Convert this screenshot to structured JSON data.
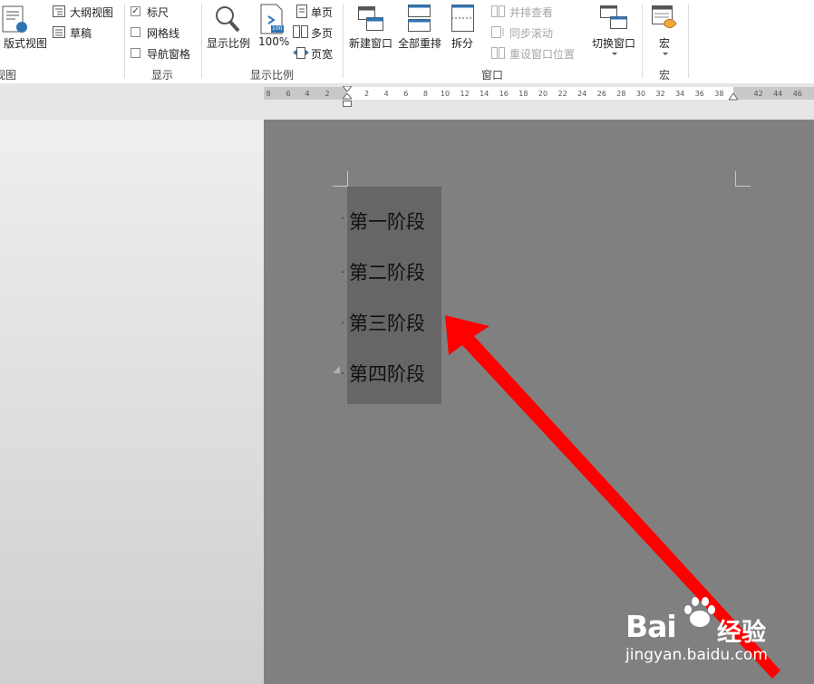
{
  "ribbon": {
    "view_group": {
      "print_layout_label": "版式视图",
      "outline_label": "大纲视图",
      "draft_label": "草稿",
      "group_label": "视图"
    },
    "show_group": {
      "ruler_label": "标尺",
      "ruler_checked": "✓",
      "gridlines_label": "网格线",
      "nav_pane_label": "导航窗格",
      "group_label": "显示"
    },
    "zoom_group": {
      "zoom_label": "显示比例",
      "hundred_label": "100%",
      "hundred_badge": "100",
      "one_page_label": "单页",
      "multi_page_label": "多页",
      "page_width_label": "页宽",
      "group_label": "显示比例"
    },
    "window_group": {
      "new_window_label": "新建窗口",
      "arrange_all_label": "全部重排",
      "split_label": "拆分",
      "side_by_side_label": "并排查看",
      "sync_scroll_label": "同步滚动",
      "reset_position_label": "重设窗口位置",
      "switch_windows_label": "切换窗口",
      "group_label": "窗口"
    },
    "macros_group": {
      "macros_label": "宏",
      "group_label": "宏"
    }
  },
  "ruler": {
    "left_ticks": [
      "8",
      "6",
      "4",
      "2"
    ],
    "right_ticks": [
      "2",
      "4",
      "6",
      "8",
      "10",
      "12",
      "14",
      "16",
      "18",
      "20",
      "22",
      "24",
      "26",
      "28",
      "30",
      "32",
      "34",
      "36",
      "38",
      "42",
      "44",
      "46"
    ]
  },
  "document": {
    "lines": [
      "第一阶段",
      "第二阶段",
      "第三阶段",
      "第四阶段"
    ]
  },
  "watermark": {
    "brand": "Bai",
    "brand_suffix": "经验",
    "url": "jingyan.baidu.com"
  },
  "colors": {
    "document_bg": "#808080",
    "selection_bg": "#666666",
    "arrow": "#ff0000"
  }
}
